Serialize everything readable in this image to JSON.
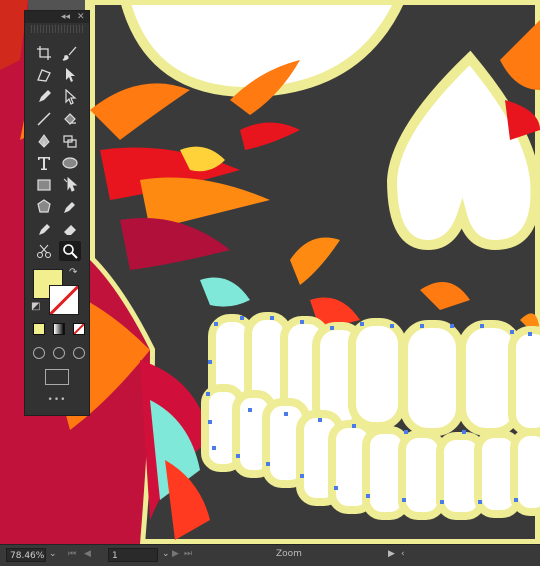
{
  "tools_panel": {
    "collapse_icon": "double-chevron-icon",
    "close_icon": "close-icon",
    "more_label": "•••"
  },
  "colors": {
    "fill": "#f1ef8e",
    "stroke_none_slash": "#e02020"
  },
  "status_bar": {
    "zoom_value": "78.46%",
    "page_value": "1",
    "tool_label": "Zoom"
  }
}
